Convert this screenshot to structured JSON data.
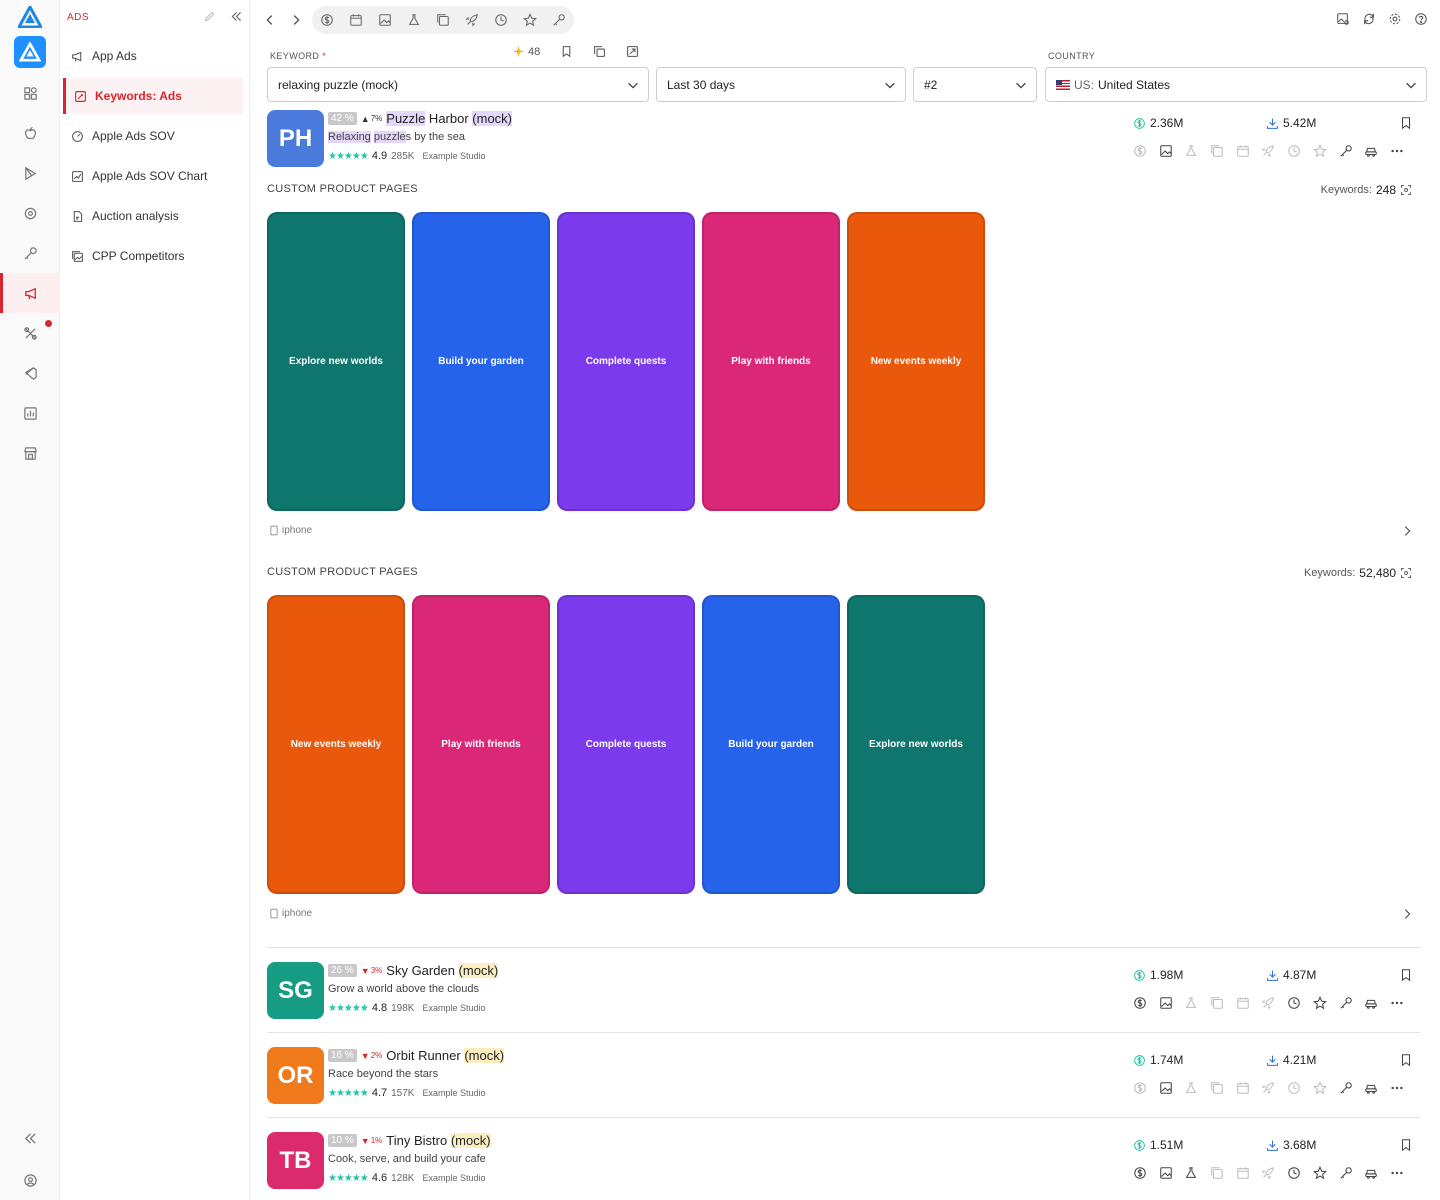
{
  "rail": {
    "items": [
      {
        "name": "dashboard-icon"
      },
      {
        "name": "apple-icon"
      },
      {
        "name": "play-store-icon"
      },
      {
        "name": "eye-icon"
      },
      {
        "name": "key-icon"
      },
      {
        "name": "megaphone-icon",
        "active": true
      },
      {
        "name": "tools-icon",
        "has_dot": true
      },
      {
        "name": "vscode-icon"
      },
      {
        "name": "report-icon"
      },
      {
        "name": "store-icon"
      }
    ]
  },
  "subnav": {
    "heading": "ADS",
    "items": [
      {
        "label": "App Ads",
        "icon": "megaphone-icon"
      },
      {
        "label": "Keywords: Ads",
        "icon": "keyword-icon",
        "active": true
      },
      {
        "label": "Apple Ads SOV",
        "icon": "gauge-icon"
      },
      {
        "label": "Apple Ads SOV Chart",
        "icon": "chart-icon"
      },
      {
        "label": "Auction analysis",
        "icon": "document-icon"
      },
      {
        "label": "CPP Competitors",
        "icon": "gallery-icon"
      }
    ]
  },
  "filters": {
    "keyword_label": "KEYWORD",
    "keyword_required": "*",
    "keyword_value": "relaxing puzzle (mock)",
    "keyword_count": "48",
    "period_value": "Last 30 days",
    "rank_value": "#2",
    "country_label": "COUNTRY",
    "country_prefix": "US:",
    "country_value": "United States"
  },
  "apps": [
    {
      "initials": "PH",
      "color": "#4a7bdc",
      "rank": "42",
      "trend": "up",
      "trend_value": "7%",
      "title_pre": "",
      "title_hl1": "Puzzle",
      "title_mid": " Harbor ",
      "title_hl2": "(mock)",
      "hl": "purple",
      "subtitle_hl1": "Relaxing",
      "subtitle_mid": " ",
      "subtitle_hl2": "puzzle",
      "subtitle_post": "s by the sea",
      "rating": "4.9",
      "ratings_count": "285K",
      "developer": "Example Studio",
      "revenue": "2.36M",
      "downloads": "5.42M"
    },
    {
      "initials": "SG",
      "color": "#179c84",
      "rank": "26",
      "trend": "down",
      "trend_value": "3%",
      "title_pre": "Sky Garden ",
      "title_hl1": "",
      "title_mid": "",
      "title_hl2": "(mock)",
      "hl": "yellow",
      "subtitle_hl1": "",
      "subtitle_mid": "",
      "subtitle_hl2": "",
      "subtitle_post": "Grow a world above the clouds",
      "rating": "4.8",
      "ratings_count": "198K",
      "developer": "Example Studio",
      "revenue": "1.98M",
      "downloads": "4.87M"
    },
    {
      "initials": "OR",
      "color": "#f07a1a",
      "rank": "16",
      "trend": "down",
      "trend_value": "2%",
      "title_pre": "Orbit Runner ",
      "title_hl1": "",
      "title_mid": "",
      "title_hl2": "(mock)",
      "hl": "yellow",
      "subtitle_hl1": "",
      "subtitle_mid": "",
      "subtitle_hl2": "",
      "subtitle_post": "Race beyond the stars",
      "rating": "4.7",
      "ratings_count": "157K",
      "developer": "Example Studio",
      "revenue": "1.74M",
      "downloads": "4.21M"
    },
    {
      "initials": "TB",
      "color": "#dc2b6c",
      "rank": "10",
      "trend": "down",
      "trend_value": "1%",
      "title_pre": "Tiny Bistro ",
      "title_hl1": "",
      "title_mid": "",
      "title_hl2": "(mock)",
      "hl": "yellow",
      "subtitle_hl1": "",
      "subtitle_mid": "",
      "subtitle_hl2": "",
      "subtitle_post": "Cook, serve, and build your cafe",
      "rating": "4.6",
      "ratings_count": "128K",
      "developer": "Example Studio",
      "revenue": "1.51M",
      "downloads": "3.68M"
    }
  ],
  "cpp_sections": [
    {
      "heading": "CUSTOM PRODUCT PAGES",
      "keywords_label": "Keywords:",
      "keywords_value": "248",
      "device": "iphone",
      "cards": [
        {
          "text": "Explore new worlds",
          "color": "#0f766e"
        },
        {
          "text": "Build your garden",
          "color": "#2563eb"
        },
        {
          "text": "Complete quests",
          "color": "#7c3aed"
        },
        {
          "text": "Play with friends",
          "color": "#db2777"
        },
        {
          "text": "New events weekly",
          "color": "#ea580c"
        }
      ]
    },
    {
      "heading": "CUSTOM PRODUCT PAGES",
      "keywords_label": "Keywords:",
      "keywords_value": "52,480",
      "device": "iphone",
      "cards": [
        {
          "text": "New events weekly",
          "color": "#ea580c"
        },
        {
          "text": "Play with friends",
          "color": "#db2777"
        },
        {
          "text": "Complete quests",
          "color": "#7c3aed"
        },
        {
          "text": "Build your garden",
          "color": "#2563eb"
        },
        {
          "text": "Explore new worlds",
          "color": "#0f766e"
        }
      ]
    }
  ],
  "colors": {
    "accent": "#d9262e",
    "revenue": "#22c4a8",
    "downloads": "#2b6fd6"
  }
}
